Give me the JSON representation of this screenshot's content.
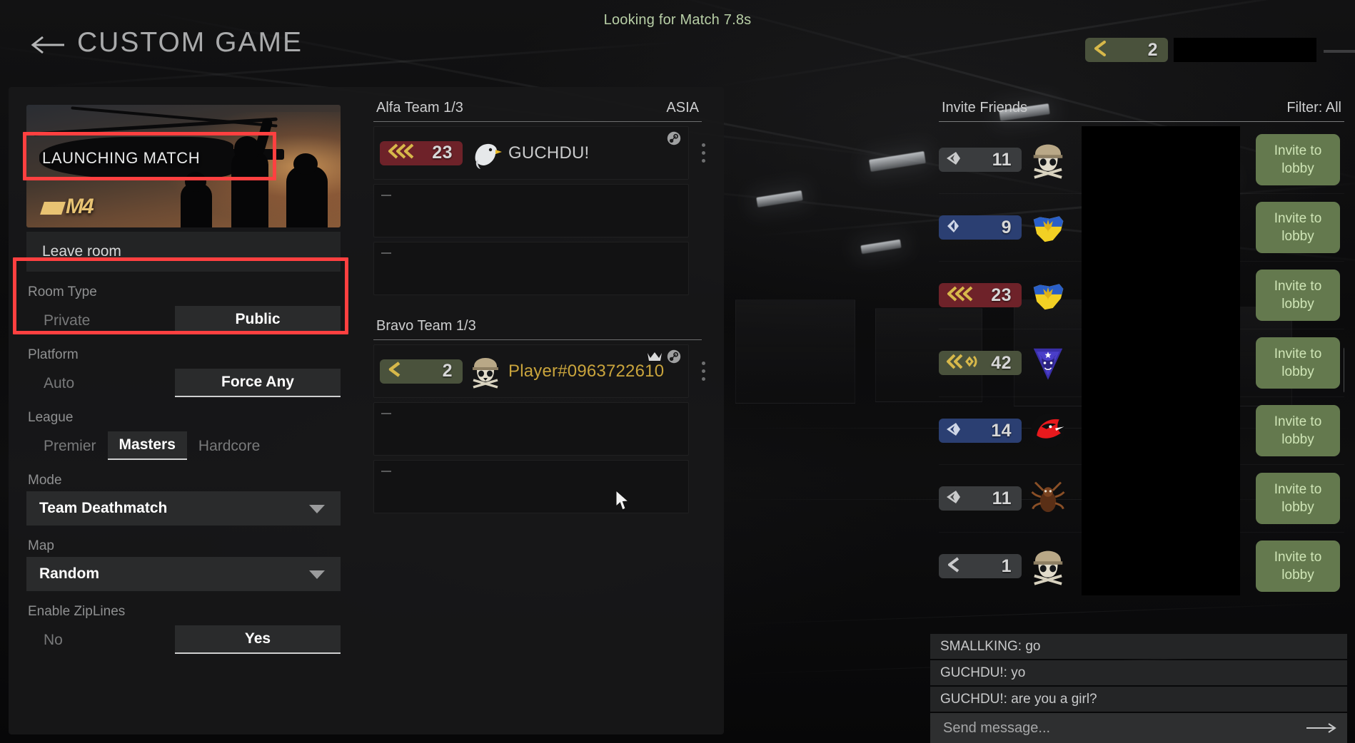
{
  "header": {
    "back_icon": "back-arrow-icon",
    "title": "CUSTOM GAME",
    "match_status": "Looking for Match 7.8s",
    "self_rank": "2"
  },
  "settings": {
    "banner_label": "LAUNCHING MATCH",
    "banner_logo": "M4",
    "leave_room_label": "Leave room",
    "room_type": {
      "label": "Room Type",
      "options": [
        "Private",
        "Public"
      ],
      "selected": "Public"
    },
    "platform": {
      "label": "Platform",
      "options": [
        "Auto",
        "Force Any"
      ],
      "selected": "Force Any"
    },
    "league": {
      "label": "League",
      "options": [
        "Premier",
        "Masters",
        "Hardcore"
      ],
      "selected": "Masters"
    },
    "mode": {
      "label": "Mode",
      "selected": "Team Deathmatch",
      "caret_icon": "chevron-down-icon"
    },
    "map": {
      "label": "Map",
      "selected": "Random",
      "caret_icon": "chevron-down-icon"
    },
    "ziplines": {
      "label": "Enable ZipLines",
      "options": [
        "No",
        "Yes"
      ],
      "selected": "Yes"
    }
  },
  "teams": [
    {
      "name": "Alfa Team 1/3",
      "region": "ASIA",
      "slots": [
        {
          "filled": true,
          "rank": "23",
          "rank_color": "red",
          "chevrons": 3,
          "player": "GUCHDU!",
          "name_color": "gray",
          "avatar": "eagle-avatar",
          "host": false,
          "platform_icon": "steam-icon"
        },
        {
          "filled": false
        },
        {
          "filled": false
        }
      ]
    },
    {
      "name": "Bravo Team 1/3",
      "region": "",
      "slots": [
        {
          "filled": true,
          "rank": "2",
          "rank_color": "olive",
          "chevrons": 1,
          "player": "Player#0963722610",
          "name_color": "gold",
          "avatar": "skull-helmet-avatar",
          "host": true,
          "platform_icon": "steam-icon"
        },
        {
          "filled": false
        },
        {
          "filled": false
        }
      ]
    }
  ],
  "friends": {
    "title": "Invite Friends",
    "filter": "Filter: All",
    "invite_label": "Invite to lobby",
    "rows": [
      {
        "rank": "11",
        "rank_color": "gray",
        "chevrons": 0,
        "avatar": "skull-helmet-avatar"
      },
      {
        "rank": "9",
        "rank_color": "blue",
        "chevrons": 0,
        "avatar": "ukraine-flag-avatar"
      },
      {
        "rank": "23",
        "rank_color": "red",
        "chevrons": 3,
        "avatar": "ukraine-flag-avatar"
      },
      {
        "rank": "42",
        "rank_color": "olive",
        "chevrons": 3,
        "avatar": "wolf-emblem-avatar"
      },
      {
        "rank": "14",
        "rank_color": "blue",
        "chevrons": 0,
        "avatar": "red-bird-avatar"
      },
      {
        "rank": "11",
        "rank_color": "gray",
        "chevrons": 0,
        "avatar": "spider-avatar"
      },
      {
        "rank": "1",
        "rank_color": "gray",
        "chevrons": 1,
        "avatar": "skull-helmet-avatar"
      }
    ]
  },
  "chat": {
    "messages": [
      "SMALLKING: go",
      "GUCHDU!: yo",
      "GUCHDU!: are you a girl?"
    ],
    "placeholder": "Send message...",
    "send_icon": "arrow-right-icon"
  },
  "annotations": {
    "highlight_color": "#ff4040"
  }
}
